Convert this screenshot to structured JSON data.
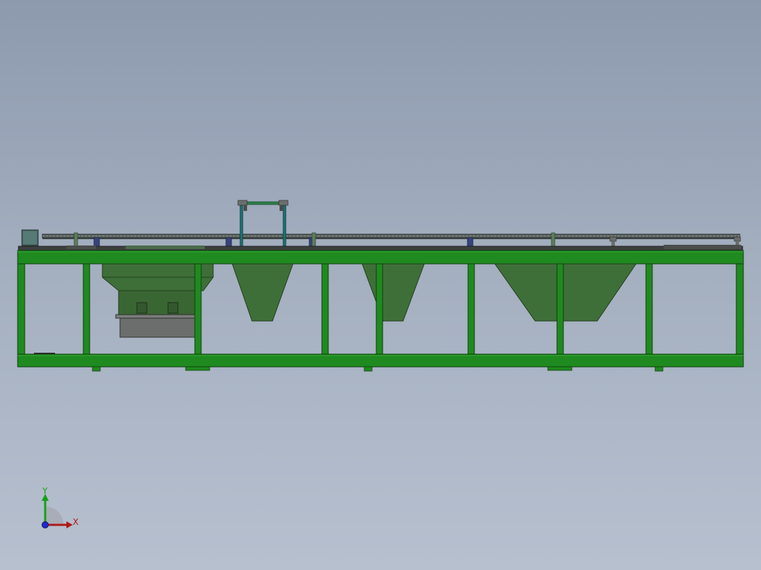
{
  "scene": {
    "model": "conveyor-hopper-frame-assembly",
    "view": "front",
    "colors": {
      "background_top": "#8d9aae",
      "background_bottom": "#b7c0cf",
      "frame": "#1f8a1f",
      "frame_edge": "#0f3f0f",
      "hopper": "#3f6f38",
      "hopper_edge": "#223d1e",
      "rail": "#4f5b58",
      "pillar": "#1f6f6f",
      "gearbox": "#6b6e6c",
      "support_block": "#36447a"
    }
  },
  "triad": {
    "y_label": "Y",
    "x_label": "X",
    "y_color": "#16a016",
    "x_color": "#b01818",
    "z_color": "#1d2ad0"
  }
}
